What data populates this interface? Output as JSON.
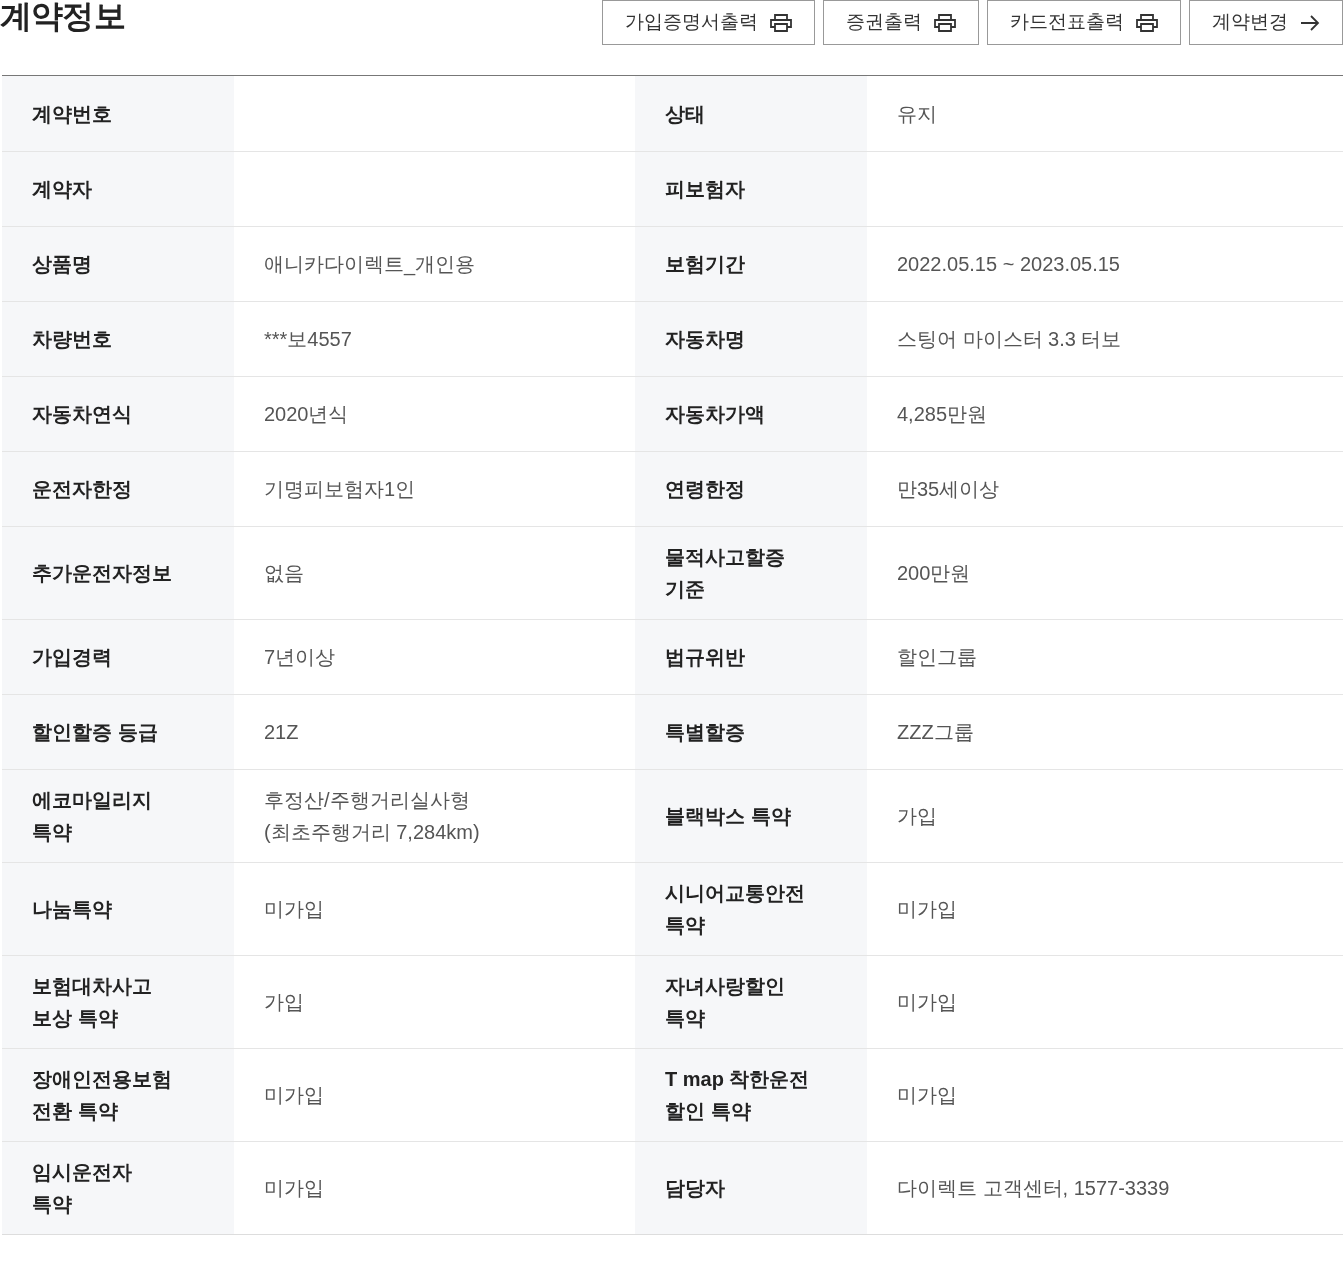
{
  "title": "계약정보",
  "buttons": [
    {
      "label": "가입증명서출력",
      "kind": "print"
    },
    {
      "label": "증권출력",
      "kind": "print"
    },
    {
      "label": "카드전표출력",
      "kind": "print"
    },
    {
      "label": "계약변경",
      "kind": "arrow"
    }
  ],
  "rows": [
    [
      {
        "label": "계약번호"
      },
      {
        "label": "상태",
        "value": "유지"
      }
    ],
    [
      {
        "label": "계약자"
      },
      {
        "label": "피보험자"
      }
    ],
    [
      {
        "label": "상품명",
        "value": "애니카다이렉트_개인용"
      },
      {
        "label": "보험기간",
        "value": "2022.05.15 ~ 2023.05.15"
      }
    ],
    [
      {
        "label": "차량번호",
        "value": "***보4557"
      },
      {
        "label": "자동차명",
        "value": "스팅어 마이스터 3.3 터보"
      }
    ],
    [
      {
        "label": "자동차연식",
        "value": "2020년식"
      },
      {
        "label": "자동차가액",
        "value": "4,285만원"
      }
    ],
    [
      {
        "label": "운전자한정",
        "value": "기명피보험자1인"
      },
      {
        "label": "연령한정",
        "value": "만35세이상"
      }
    ],
    [
      {
        "label": "추가운전자정보",
        "value": "없음"
      },
      {
        "label": "물적사고할증\n기준",
        "value": "200만원"
      }
    ],
    [
      {
        "label": "가입경력",
        "value": "7년이상"
      },
      {
        "label": "법규위반",
        "value": "할인그룹"
      }
    ],
    [
      {
        "label": "할인할증 등급",
        "value": "21Z"
      },
      {
        "label": "특별할증",
        "value": "ZZZ그룹"
      }
    ],
    [
      {
        "label": "에코마일리지\n특약",
        "value": "후정산/주행거리실사형\n(최초주행거리 7,284km)"
      },
      {
        "label": "블랙박스 특약",
        "value": "가입"
      }
    ],
    [
      {
        "label": "나눔특약",
        "value": "미가입"
      },
      {
        "label": "시니어교통안전\n특약",
        "value": "미가입"
      }
    ],
    [
      {
        "label": "보험대차사고\n보상 특약",
        "value": "가입"
      },
      {
        "label": "자녀사랑할인\n특약",
        "value": "미가입"
      }
    ],
    [
      {
        "label": "장애인전용보험\n전환 특약",
        "value": "미가입"
      },
      {
        "label": "T map 착한운전\n할인 특약",
        "value": "미가입"
      }
    ],
    [
      {
        "label": "임시운전자\n특약",
        "value": "미가입"
      },
      {
        "label": "담당자",
        "value": "다이렉트 고객센터, 1577-3339"
      }
    ]
  ]
}
